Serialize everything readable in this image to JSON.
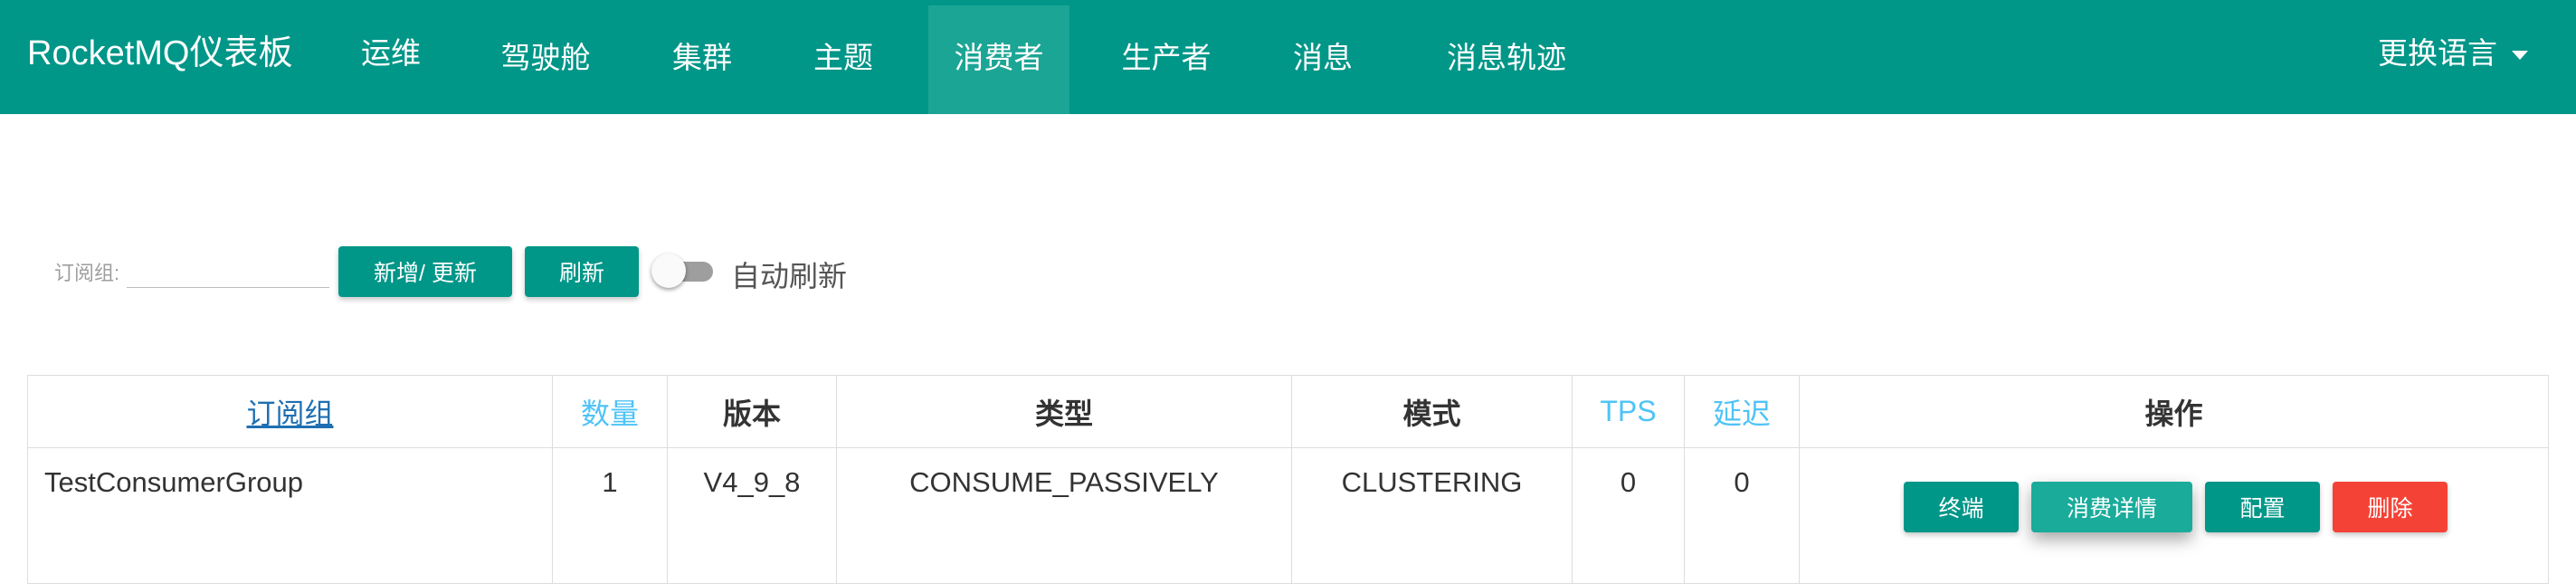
{
  "brand": "RocketMQ仪表板",
  "nav": [
    {
      "label": "运维",
      "active": false
    },
    {
      "label": "驾驶舱",
      "active": false
    },
    {
      "label": "集群",
      "active": false
    },
    {
      "label": "主题",
      "active": false
    },
    {
      "label": "消费者",
      "active": true
    },
    {
      "label": "生产者",
      "active": false
    },
    {
      "label": "消息",
      "active": false
    },
    {
      "label": "消息轨迹",
      "active": false
    }
  ],
  "language_menu": "更换语言",
  "toolbar": {
    "filter_label": "订阅组:",
    "filter_value": "",
    "add_update_label": "新增/ 更新",
    "refresh_label": "刷新",
    "auto_refresh_label": "自动刷新",
    "auto_refresh_on": false
  },
  "table": {
    "headers": [
      "订阅组",
      "数量",
      "版本",
      "类型",
      "模式",
      "TPS",
      "延迟",
      "操作"
    ],
    "rows": [
      {
        "group": "TestConsumerGroup",
        "count": "1",
        "version": "V4_9_8",
        "type": "CONSUME_PASSIVELY",
        "mode": "CLUSTERING",
        "tps": "0",
        "delay": "0",
        "actions": {
          "client": "终端",
          "detail": "消费详情",
          "config": "配置",
          "delete": "删除"
        }
      }
    ]
  },
  "colors": {
    "primary": "#009688",
    "active_nav": "#1ba595",
    "danger": "#f44336",
    "sortable_header": "#4fc3f7",
    "link": "#1f6fb2"
  }
}
